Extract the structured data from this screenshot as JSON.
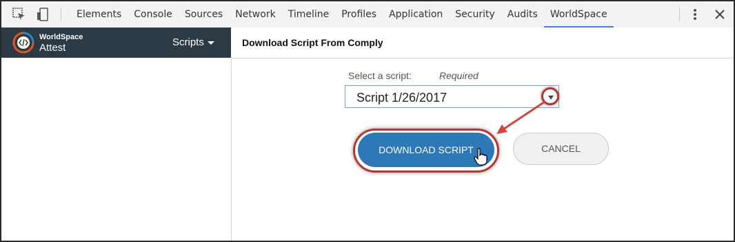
{
  "devtools": {
    "tabs": [
      "Elements",
      "Console",
      "Sources",
      "Network",
      "Timeline",
      "Profiles",
      "Application",
      "Security",
      "Audits",
      "WorldSpace"
    ],
    "active_tab": "WorldSpace"
  },
  "brand": {
    "top": "WorldSpace",
    "bottom": "Attest",
    "menu_label": "Scripts"
  },
  "panel": {
    "title": "Download Script From Comply",
    "select_label": "Select a script:",
    "required_label": "Required",
    "selected_script": "Script 1/26/2017",
    "download_label": "DOWNLOAD SCRIPT",
    "cancel_label": "CANCEL"
  },
  "colors": {
    "brand_bar": "#2b3a44",
    "primary_button": "#2e78b7",
    "annotation_red": "#b8342f",
    "active_tab_underline": "#3e82f7"
  }
}
